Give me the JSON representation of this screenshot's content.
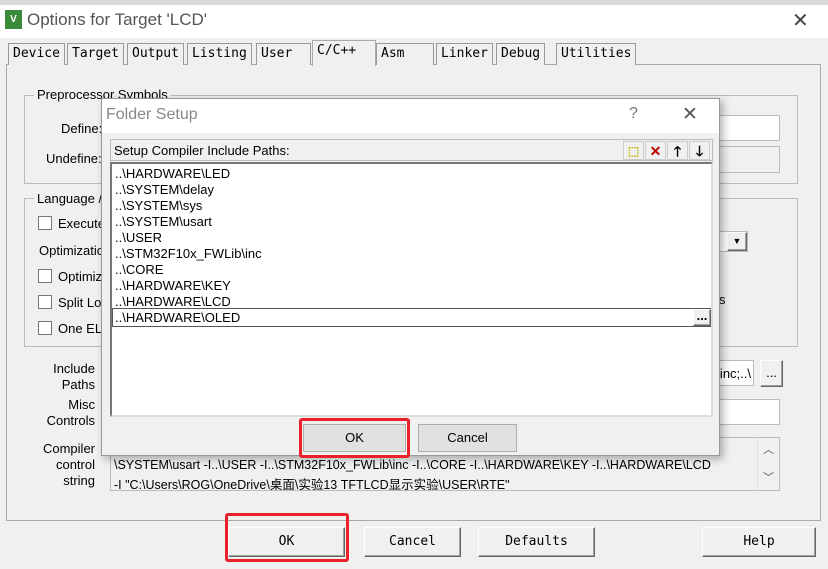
{
  "window": {
    "title": "Options for Target 'LCD'",
    "icon": "keil-uvision-icon"
  },
  "tabs": [
    {
      "label": "Device"
    },
    {
      "label": "Target"
    },
    {
      "label": "Output"
    },
    {
      "label": "Listing"
    },
    {
      "label": "User"
    },
    {
      "label": "C/C++",
      "active": true
    },
    {
      "label": "Asm"
    },
    {
      "label": "Linker"
    },
    {
      "label": "Debug"
    },
    {
      "label": "Utilities"
    }
  ],
  "preprocessor": {
    "group_label": "Preprocessor Symbols",
    "define_label": "Define:",
    "undefine_label": "Undefine:"
  },
  "language": {
    "group_label": "Language / Code Generation",
    "execute_label": "Execute-only Code",
    "optimization_label": "Optimization:",
    "optimize_label": "Optimize for Time",
    "split_label": "Split Load and Store Multiple",
    "one_elf_label": "One ELF Section per Function",
    "partial_text": "s"
  },
  "include": {
    "label1": "Include",
    "label2": "Paths",
    "value": "\\inc;..\\",
    "browse": "..."
  },
  "misc": {
    "label1": "Misc",
    "label2": "Controls",
    "value": ""
  },
  "compiler": {
    "label1": "Compiler",
    "label2": "control",
    "label3": "string",
    "line2": "\\SYSTEM\\usart -I..\\USER -I..\\STM32F10x_FWLib\\inc -I..\\CORE -I..\\HARDWARE\\KEY -I..\\HARDWARE\\LCD",
    "line3": "-I \"C:\\Users\\ROG\\OneDrive\\桌面\\实验13 TFTLCD显示实验\\USER\\RTE\""
  },
  "buttons": {
    "ok": "OK",
    "cancel": "Cancel",
    "defaults": "Defaults",
    "help": "Help"
  },
  "folder_setup": {
    "title": "Folder Setup",
    "help": "?",
    "header": "Setup Compiler Include Paths:",
    "toolbar_icons": [
      "new-folder-icon",
      "delete-icon",
      "move-up-icon",
      "move-down-icon"
    ],
    "paths": [
      "..\\HARDWARE\\LED",
      "..\\SYSTEM\\delay",
      "..\\SYSTEM\\sys",
      "..\\SYSTEM\\usart",
      "..\\USER",
      "..\\STM32F10x_FWLib\\inc",
      "..\\CORE",
      "..\\HARDWARE\\KEY",
      "..\\HARDWARE\\LCD"
    ],
    "editing_path": "..\\HARDWARE\\OLED",
    "browse": "...",
    "ok": "OK",
    "cancel": "Cancel"
  },
  "colors": {
    "highlight": "#e8212b"
  }
}
